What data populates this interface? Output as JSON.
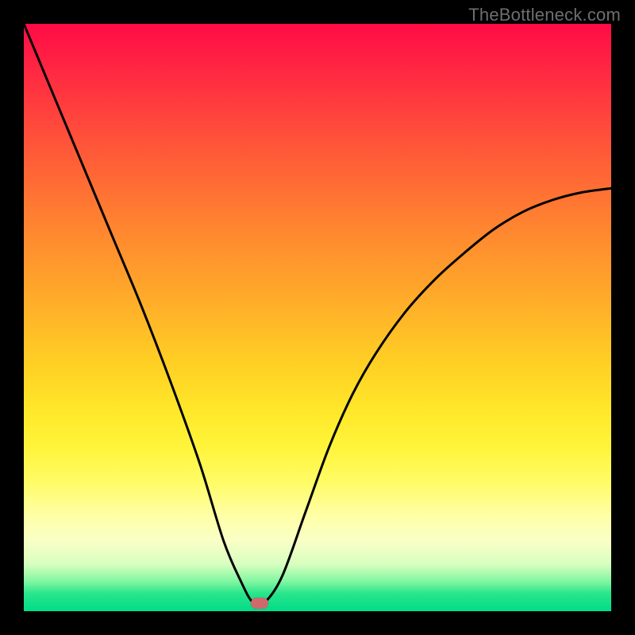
{
  "watermark": "TheBottleneck.com",
  "marker": {
    "cx_frac": 0.402,
    "cy_frac": 0.986,
    "color": "#d06a6a"
  },
  "chart_data": {
    "type": "line",
    "title": "",
    "xlabel": "",
    "ylabel": "",
    "xlim": [
      0,
      1
    ],
    "ylim": [
      0,
      1
    ],
    "series": [
      {
        "name": "curve",
        "x": [
          0.0,
          0.05,
          0.1,
          0.15,
          0.2,
          0.25,
          0.3,
          0.34,
          0.37,
          0.39,
          0.41,
          0.44,
          0.48,
          0.52,
          0.56,
          0.6,
          0.65,
          0.7,
          0.75,
          0.8,
          0.85,
          0.9,
          0.95,
          1.0
        ],
        "y": [
          1.0,
          0.88,
          0.76,
          0.64,
          0.52,
          0.39,
          0.25,
          0.12,
          0.05,
          0.015,
          0.015,
          0.06,
          0.17,
          0.28,
          0.37,
          0.44,
          0.51,
          0.565,
          0.61,
          0.65,
          0.68,
          0.7,
          0.713,
          0.72
        ]
      }
    ],
    "gradient_stops": [
      {
        "pos": 0.0,
        "color": "#ff0b46"
      },
      {
        "pos": 0.5,
        "color": "#ffd024"
      },
      {
        "pos": 0.88,
        "color": "#f9ffc6"
      },
      {
        "pos": 1.0,
        "color": "#00dd88"
      }
    ]
  }
}
